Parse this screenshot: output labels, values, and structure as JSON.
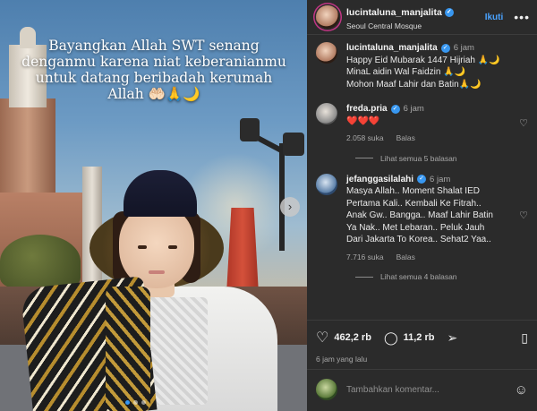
{
  "photo": {
    "overlay_text": "Bayangkan Allah SWT senang denganmu karena niat keberanianmu untuk datang beribadah kerumah Allah 🤲🏻🙏🌙",
    "next_arrow": "›"
  },
  "header": {
    "username": "lucintaluna_manjalita",
    "verified_mark": "✓",
    "location": "Seoul Central Mosque",
    "follow_label": "Ikuti",
    "more_label": "•••"
  },
  "caption": {
    "username": "lucintaluna_manjalita",
    "time": "6 jam",
    "lines": [
      "Happy Eid Mubarak 1447 Hijriah 🙏🌙",
      "MinaL aidin Wal Faidzin 🙏🌙",
      "Mohon Maaf Lahir dan Batin🙏🌙"
    ]
  },
  "comments": [
    {
      "username": "freda.pria",
      "verified": true,
      "time": "6 jam",
      "lines": [
        "❤️❤️❤️"
      ],
      "likes": "2.058 suka",
      "reply_label": "Balas",
      "view_replies": "Lihat semua 5 balasan"
    },
    {
      "username": "jefanggasilalahi",
      "verified": true,
      "time": "6 jam",
      "lines": [
        "Masya Allah.. Moment Shalat IED",
        "Pertama Kali.. Kembali Ke Fitrah..",
        "Anak Gw.. Bangga.. Maaf Lahir Batin",
        "Ya Nak.. Met Lebaran.. Peluk Jauh",
        "Dari Jakarta To Korea.. Sehat2 Yaa.."
      ],
      "likes": "7.716 suka",
      "reply_label": "Balas",
      "view_replies": "Lihat semua 4 balasan"
    }
  ],
  "actions": {
    "like_count": "462,2 rb",
    "comment_count": "11,2 rb",
    "time_ago": "6 jam yang lalu"
  },
  "composer": {
    "placeholder": "Tambahkan komentar..."
  },
  "icons": {
    "like": "heart-outline-icon",
    "comment": "comment-bubble-icon",
    "share": "paper-plane-icon",
    "save": "bookmark-icon",
    "emoji": "smiley-icon"
  },
  "colors": {
    "panel_bg": "#2b2b2b",
    "accent_blue": "#3897f0",
    "follow_blue": "#4aa3ff"
  }
}
